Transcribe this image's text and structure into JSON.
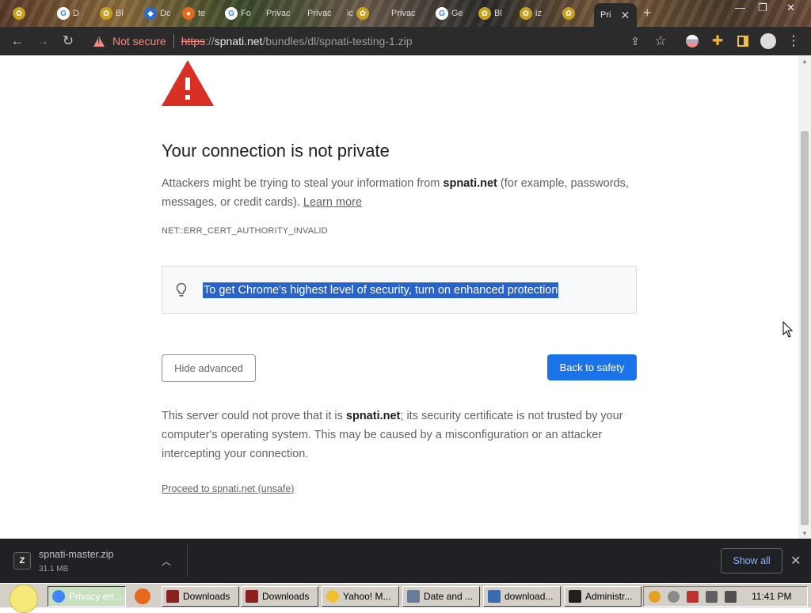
{
  "tabs": [
    {
      "label": "",
      "favicon": "spnati-icon"
    },
    {
      "label": "D",
      "favicon": "google-icon"
    },
    {
      "label": "Bl",
      "favicon": "spnati-icon"
    },
    {
      "label": "Dc",
      "favicon": "microsoft-icon"
    },
    {
      "label": "te",
      "favicon": "firefox-icon"
    },
    {
      "label": "Fo",
      "favicon": "google-icon"
    },
    {
      "label": "Privac",
      "favicon": ""
    },
    {
      "label": "Privac",
      "favicon": ""
    },
    {
      "label": "ic",
      "favicon": "spnati-icon"
    },
    {
      "label": "Privac",
      "favicon": ""
    },
    {
      "label": "Ge",
      "favicon": "google-icon"
    },
    {
      "label": "Bl",
      "favicon": "spnati-icon"
    },
    {
      "label": "iz",
      "favicon": "spnati-icon"
    },
    {
      "label": "",
      "favicon": "spnati-icon"
    }
  ],
  "active_tab": {
    "label": "Pri",
    "close": "✕"
  },
  "new_tab": "+",
  "window_controls": {
    "minimize": "—",
    "maximize": "❐",
    "close": "✕"
  },
  "toolbar": {
    "security_label": "Not secure",
    "url_scheme": "https",
    "url_sep": "://",
    "url_host": "spnati.net",
    "url_path": "/bundles/dl/spnati-testing-1.zip"
  },
  "page": {
    "heading": "Your connection is not private",
    "desc_1": "Attackers might be trying to steal your information from ",
    "desc_host": "spnati.net",
    "desc_2": " (for example, passwords, messages, or credit cards). ",
    "learn_more": "Learn more",
    "error_code": "NET::ERR_CERT_AUTHORITY_INVALID",
    "enhanced_protection": "To get Chrome's highest level of security, turn on enhanced protection",
    "hide_advanced": "Hide advanced",
    "back_to_safety": "Back to safety",
    "details_1": "This server could not prove that it is ",
    "details_host": "spnati.net",
    "details_2": "; its security certificate is not trusted by your computer's operating system. This may be caused by a misconfiguration or an attacker intercepting your connection.",
    "proceed": "Proceed to spnati.net (unsafe)"
  },
  "download_bar": {
    "file_name": "spnati-master.zip",
    "file_size": "31.1 MB",
    "file_icon_text": "Z",
    "show_all": "Show all"
  },
  "taskbar": {
    "tasks": [
      {
        "label": "Privacy err...",
        "icon_color": "#4285f4"
      },
      {
        "label": "Downloads",
        "icon_color": "#8a2020"
      },
      {
        "label": "Downloads",
        "icon_color": "#8a2020"
      },
      {
        "label": "Yahoo! M...",
        "icon_color": "#f0c030"
      },
      {
        "label": "Date and ...",
        "icon_color": "#6a7a9a"
      },
      {
        "label": "download...",
        "icon_color": "#3a6ab0"
      },
      {
        "label": "Administr...",
        "icon_color": "#202020"
      }
    ],
    "clock": "11:41 PM"
  },
  "colors": {
    "accent_blue": "#1a73e8",
    "warning_red": "#d93025",
    "selection_blue": "#2962c8",
    "not_secure_red": "#f28b82"
  }
}
